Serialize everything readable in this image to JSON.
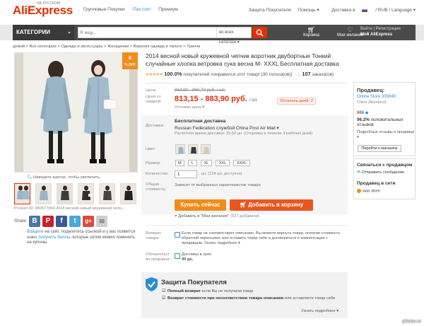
{
  "header": {
    "logo": "AliExpress",
    "logo_sub": "НА РУССКОМ",
    "links": [
      "Групповые Покупки",
      "iTao.com",
      "Премиум"
    ],
    "right": {
      "protection": "Защита Покупателя",
      "help": "Помощь ▾",
      "delivery": "Доставка в",
      "currency": "/ RUB / Language ▾"
    }
  },
  "nav": {
    "categories": "КАТЕГОРИИ",
    "search_placeholder": "Я ищу...",
    "search_category": "во всех категори ▾",
    "cart": "Корзина",
    "wishlist": "Мои желания",
    "signin": "Войти | Регистрация",
    "myae": "Мой AliExpress"
  },
  "breadcrumb": "домой > Все категории > Одежда и аксессуары > Женщинам > Верхняя одежда и пальто > Тренчи",
  "gallery": {
    "discount_value": "8",
    "discount_unit": "% OFF",
    "zoom_hint": "Наведите курсор, чтобы увеличить",
    "product_id": "Product ID: 980577054 2014 весной новый кружевной чепч..."
  },
  "share": {
    "label": "Share:",
    "buttons": [
      "B",
      "P",
      "f",
      "t",
      "g+",
      "✉"
    ],
    "promo_link1": "Войдите",
    "promo_text1": " на сайт, поделитесь ссылкой и у вас появится шанс ",
    "promo_link2": "получить баллы",
    "promo_text2": ", которые затем можно поменять на купоны."
  },
  "product": {
    "title": "2014 весной новый кружевной чепчик воротник двубортные Тонкий случайные хлопка ветровка сука весна М- XXXL Бесплатная доставка",
    "stars": "★★★★★",
    "rating_pct": "100.0%",
    "rating_text": "покупателей понравился этот товар! (30 голоса(ов))",
    "orders_count": "107",
    "orders_label": "заказа(ов)",
    "price_label": "Цена:",
    "old_price": "863,90 - 960,70 руб. / шт.",
    "discount_label_1": "Цена со",
    "discount_label_2": "скидкой:",
    "new_price": "813,15 - 883,90 руб.",
    "unit": "/ шт.",
    "days_left": "Осталось дней: 2",
    "wholesale": "Оптовая цена ▾",
    "shipping_label": "Доставка:",
    "shipping_title": "Бесплатная доставка",
    "shipping_via": "Russian Federation службой China Post Air Mail",
    "shipping_time": "Расчётное время доставки: 15-50 дн. (Отправка в течение 3 рабочих дней)",
    "color_label": "Цвет:",
    "size_label": "Размер:",
    "sizes": [
      "M",
      "L",
      "XL",
      "XXL",
      "XXXL"
    ],
    "qty_label": "Количество:",
    "qty_value": "1",
    "qty_note": "шт. (124 шт. доступно)",
    "total_label_1": "Общая",
    "total_label_2": "стоимость:",
    "total_note": "Зависит от выбранных характеристик товара",
    "buy_now": "Купить сейчас",
    "add_to_cart": "Добавить в корзину",
    "wishlist": "Добавить в \"Мои желания\"",
    "wishlist_count": "(527 добавили)",
    "return_label_1": "Возврат",
    "return_label_2": "товара:",
    "return_text": "Если товар не соответствует описанию, Вы можете вернуть товар, оплатив стоимость обратной пересылки, или оставить товар себе и договориться о компенсации с продавцом. Узнать подробнее ▾",
    "commit_label_1": "Обязательст",
    "commit_label_2": "во продавца:",
    "commit_text_1": "Доставка в срок:",
    "commit_text_2": "90 дн."
  },
  "buyer_protection": {
    "title": "Защита Покупателя",
    "line1_bold": "Полный возврат",
    "line1": " если Вы не получили товар",
    "line2_bold": "Возврат стоимости при несоответствии товара описанию",
    "line2": " или оставляете товар себе",
    "more": "Узнать подробнее ▾"
  },
  "seller": {
    "title": "Продавец:",
    "store": "Online Store 335646",
    "location": "China (Mainland)",
    "score": "866",
    "positive": "96.2%",
    "positive_text": " положительных отзывов",
    "details": "Подробные отзывы о продавце ▾",
    "store_button": "Перейти к магазину",
    "contact_title": "Связаться с продавцом",
    "contact_msg": "Отправить сообщение",
    "online_title": "Продавец в сети",
    "online_user": "xiao shen"
  },
  "watermark": "pikabu.ru",
  "colors": {
    "brand": "#e62e04",
    "orange": "#f18c1b",
    "link": "#2b8ed3"
  }
}
